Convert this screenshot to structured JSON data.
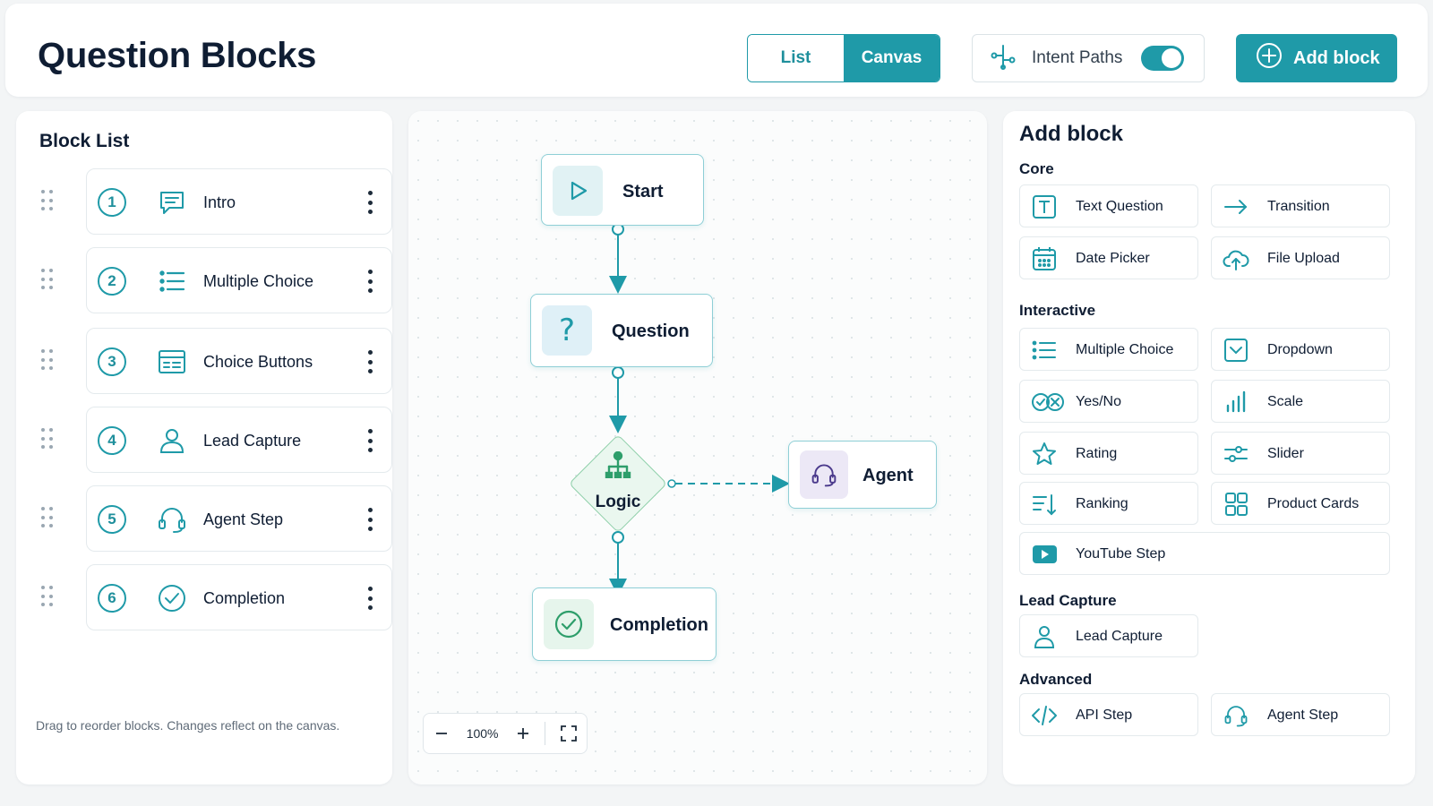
{
  "header": {
    "title": "Question Blocks",
    "view_toggle": {
      "list": "List",
      "canvas": "Canvas",
      "active": "canvas"
    },
    "intent_paths": {
      "label": "Intent Paths",
      "enabled": true
    },
    "add_block_label": "Add block"
  },
  "block_list": {
    "title": "Block List",
    "items": [
      {
        "number": "1",
        "label": "Intro",
        "icon": "chat-icon"
      },
      {
        "number": "2",
        "label": "Multiple Choice",
        "icon": "list-icon"
      },
      {
        "number": "3",
        "label": "Choice Buttons",
        "icon": "buttons-icon"
      },
      {
        "number": "4",
        "label": "Lead Capture",
        "icon": "user-icon"
      },
      {
        "number": "5",
        "label": "Agent Step",
        "icon": "headset-icon"
      },
      {
        "number": "6",
        "label": "Completion",
        "icon": "check-circle-icon"
      }
    ],
    "hint": "Drag to reorder blocks. Changes reflect on the canvas."
  },
  "canvas": {
    "nodes": {
      "start": "Start",
      "question": "Question",
      "logic": "Logic",
      "agent": "Agent",
      "completion": "Completion"
    },
    "zoom": "100%"
  },
  "palette": {
    "title": "Add block",
    "sections": {
      "core": {
        "title": "Core",
        "items": [
          "Text Question",
          "Transition",
          "Date Picker",
          "File Upload"
        ]
      },
      "interactive": {
        "title": "Interactive",
        "items": [
          "Multiple Choice",
          "Dropdown",
          "Yes/No",
          "Scale",
          "Rating",
          "Slider",
          "Ranking",
          "Product Cards",
          "YouTube Step"
        ]
      },
      "lead_capture": {
        "title": "Lead Capture",
        "items": [
          "Lead Capture"
        ]
      },
      "advanced": {
        "title": "Advanced",
        "items": [
          "API Step",
          "Agent Step"
        ]
      }
    }
  },
  "colors": {
    "accent": "#1f9aa8",
    "text": "#0f1d33",
    "logic_green": "#2e9e6b",
    "agent_purple": "#4b3a8c"
  }
}
